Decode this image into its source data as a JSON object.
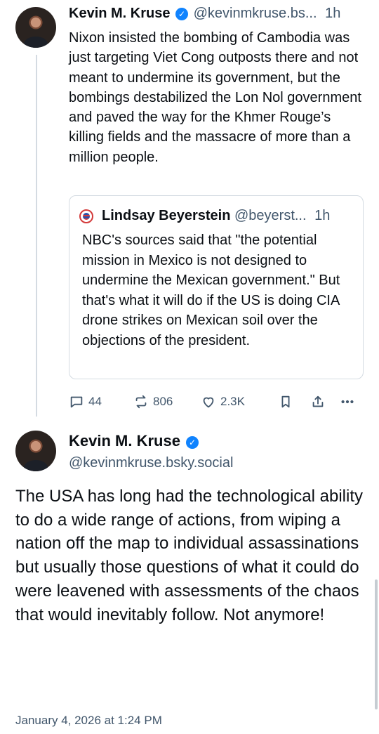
{
  "parent_post": {
    "author_name": "Kevin M. Kruse",
    "handle": "@kevinmkruse.bs...",
    "time": "1h",
    "text": "Nixon insisted the bombing of Cambodia was just targeting Viet Cong outposts there and not meant to undermine its government, but the bombings destabilized the Lon Nol government and paved the way for the Khmer Rouge’s killing fields and the massacre of more than a million people.",
    "quote": {
      "author_name": "Lindsay Beyerstein",
      "handle": "@beyerst...",
      "time": "1h",
      "text": "NBC's sources said that \"the potential mission in Mexico is not designed to undermine the Mexican government.\" But that's what it will do if the US is doing CIA drone strikes on Mexican soil over the objections of the president."
    },
    "actions": {
      "replies": "44",
      "reposts": "806",
      "likes": "2.3K"
    }
  },
  "main_post": {
    "author_name": "Kevin M. Kruse",
    "handle": "@kevinmkruse.bsky.social",
    "text": "The USA has long had the technological ability to do a wide range of actions, from wiping a nation off the map to individual assassinations but usually those questions of what it could do were leavened with assessments of the chaos that would inevitably follow. Not anymore!",
    "timestamp": "January 4, 2026 at 1:24 PM"
  },
  "colors": {
    "verified": "#1083fe",
    "secondary_text": "#42576c",
    "border": "#d4dbe2"
  }
}
